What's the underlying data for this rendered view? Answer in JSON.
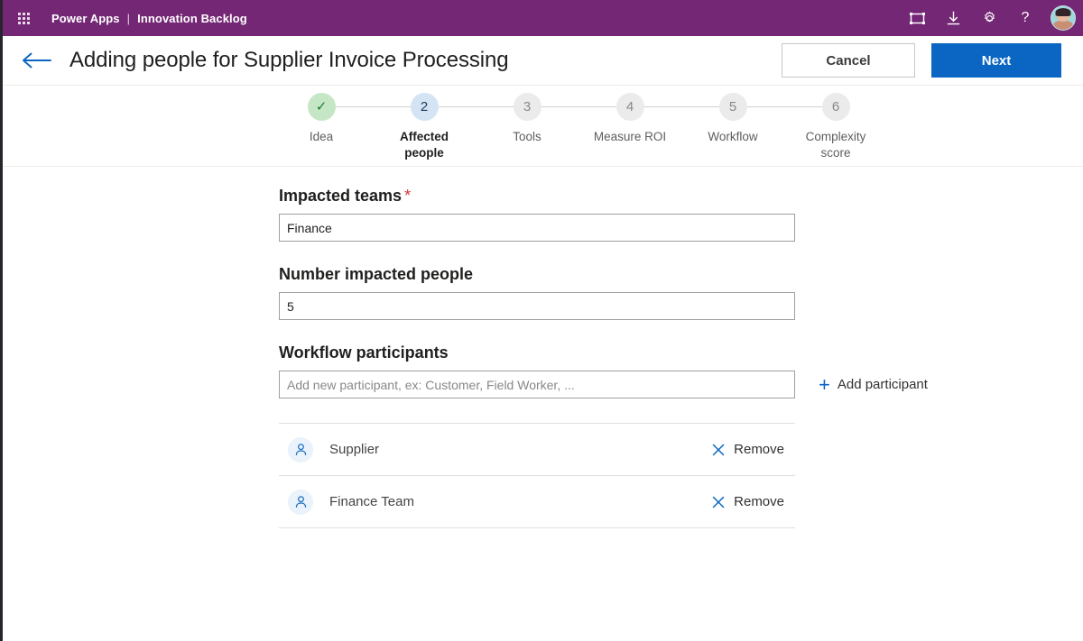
{
  "suite": {
    "waffle_icon": "app-launcher-grid-icon",
    "product": "Power Apps",
    "separator": "|",
    "app_name": "Innovation Backlog",
    "actions": [
      {
        "name": "fit-to-screen-icon",
        "label": "Fit to screen"
      },
      {
        "name": "download-icon",
        "label": "Download"
      },
      {
        "name": "gear-icon",
        "label": "Settings"
      },
      {
        "name": "help-icon",
        "label": "?"
      }
    ],
    "avatar_label": "Account manager"
  },
  "titlebar": {
    "back_icon": "back-arrow-icon",
    "title": "Adding people for Supplier Invoice Processing",
    "cancel_label": "Cancel",
    "next_label": "Next"
  },
  "stepper": {
    "steps": [
      {
        "number": "1",
        "label": "Idea",
        "state": "done",
        "marker": "✓"
      },
      {
        "number": "2",
        "label": "Affected people",
        "state": "active",
        "marker": "2"
      },
      {
        "number": "3",
        "label": "Tools",
        "state": "todo",
        "marker": "3"
      },
      {
        "number": "4",
        "label": "Measure ROI",
        "state": "todo",
        "marker": "4"
      },
      {
        "number": "5",
        "label": "Workflow",
        "state": "todo",
        "marker": "5"
      },
      {
        "number": "6",
        "label": "Complexity score",
        "state": "todo",
        "marker": "6"
      }
    ]
  },
  "form": {
    "impacted_teams": {
      "label": "Impacted teams",
      "required_marker": "*",
      "value": "Finance",
      "placeholder": ""
    },
    "number_impacted_people": {
      "label": "Number impacted people",
      "value": "5",
      "placeholder": ""
    },
    "workflow_participants": {
      "label": "Workflow participants",
      "value": "",
      "placeholder": "Add new participant, ex: Customer, Field Worker, ...",
      "add_label": "Add participant",
      "add_icon": "plus-icon",
      "items": [
        {
          "name": "Supplier",
          "avatar_icon": "person-icon",
          "remove_label": "Remove",
          "remove_icon": "close-x-icon"
        },
        {
          "name": "Finance Team",
          "avatar_icon": "person-icon",
          "remove_label": "Remove",
          "remove_icon": "close-x-icon"
        }
      ]
    }
  },
  "colors": {
    "suite_purple": "#742774",
    "accent_blue": "#0a66c2",
    "required_red": "#d13438",
    "step_done_green": "#c6e7c6",
    "step_active_blue": "#d4e4f4",
    "step_todo_gray": "#ebebeb"
  }
}
